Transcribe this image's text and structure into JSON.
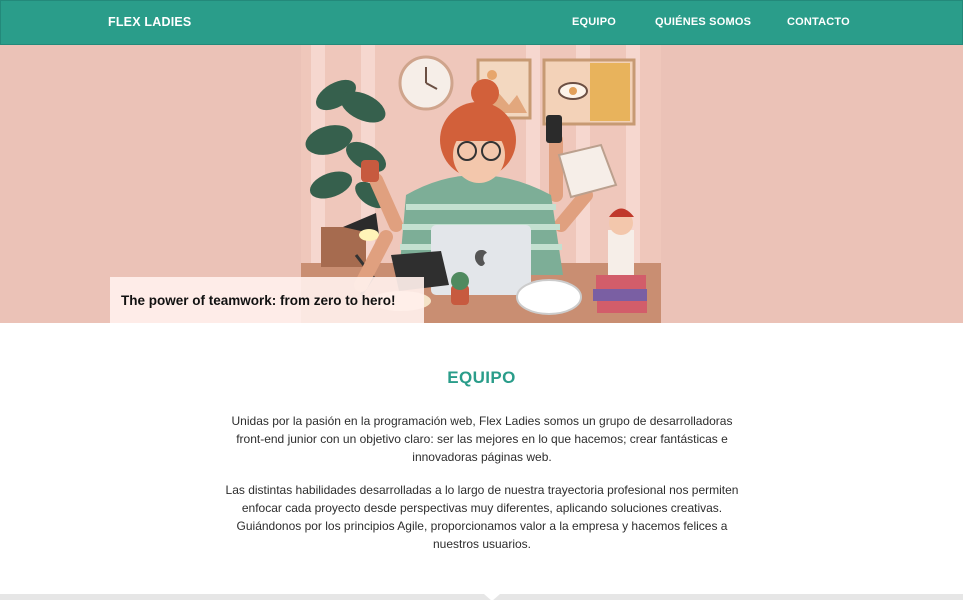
{
  "nav": {
    "brand": "FLEX LADIES",
    "links": [
      "EQUIPO",
      "QUIÉNES SOMOS",
      "CONTACTO"
    ],
    "color": "#2a9d8a"
  },
  "hero": {
    "caption": "The power of teamwork: from zero to hero!",
    "background": "#ebc2b7",
    "image": "woman-multitasking-at-desk-illustration"
  },
  "team": {
    "title": "EQUIPO",
    "paragraphs": [
      "Unidas por la pasión en la programación web, Flex Ladies somos un grupo de desarrolladoras front-end junior con un objetivo claro: ser las mejores en lo que hacemos; crear fantásticas e innovadoras páginas web.",
      "Las distintas habilidades desarrolladas a lo largo de nuestra trayectoria profesional nos permiten enfocar cada proyecto desde perspectivas muy diferentes, aplicando soluciones creativas. Guiándonos por los principios Agile, proporcionamos valor a la empresa y hacemos felices a nuestros usuarios."
    ]
  }
}
